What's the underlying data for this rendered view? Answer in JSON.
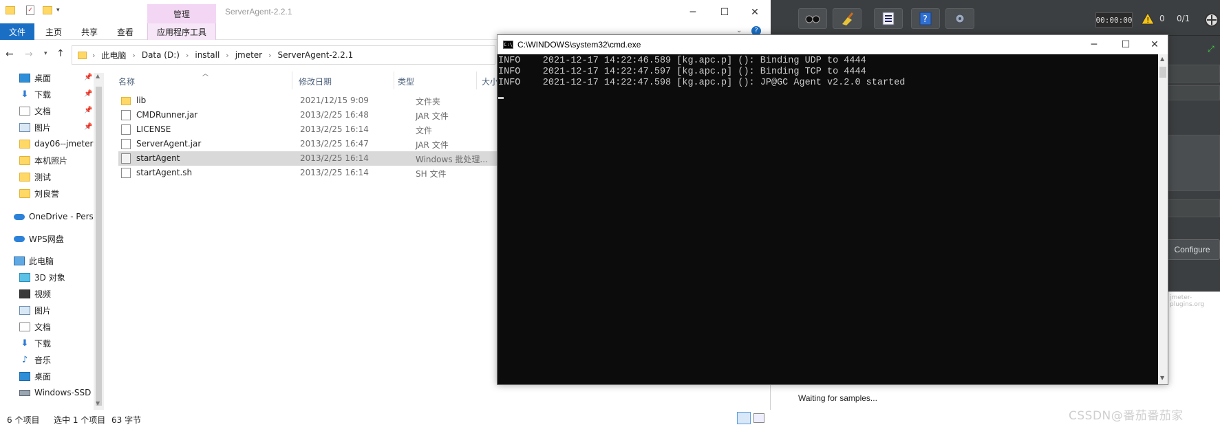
{
  "jmeter": {
    "timer": "00:00:00",
    "warning_count": "0",
    "thread_ratio": "0/1",
    "configure_label": "Configure",
    "watermark": "jmeter-plugins.org",
    "waiting_text": "Waiting for samples..."
  },
  "explorer": {
    "title": "ServerAgent-2.2.1",
    "manage_tab": "管理",
    "ribbon_tabs": [
      "文件",
      "主页",
      "共享",
      "查看",
      "应用程序工具"
    ],
    "breadcrumb": [
      "此电脑",
      "Data (D:)",
      "install",
      "jmeter",
      "ServerAgent-2.2.1"
    ],
    "nav_items": [
      {
        "label": "桌面",
        "icon": "desktop-icon",
        "pinned": true
      },
      {
        "label": "下载",
        "icon": "download-icon",
        "pinned": true
      },
      {
        "label": "文档",
        "icon": "document-icon",
        "pinned": true
      },
      {
        "label": "图片",
        "icon": "picture-icon",
        "pinned": true
      },
      {
        "label": "day06--jmeter",
        "icon": "folder-icon"
      },
      {
        "label": "本机照片",
        "icon": "folder-icon"
      },
      {
        "label": "测试",
        "icon": "folder-icon"
      },
      {
        "label": "刘良誉",
        "icon": "folder-icon"
      },
      {
        "label": "OneDrive - Perso",
        "icon": "cloud-icon"
      },
      {
        "label": "WPS网盘",
        "icon": "cloud-icon"
      },
      {
        "label": "此电脑",
        "icon": "computer-icon"
      },
      {
        "label": "3D 对象",
        "icon": "cube-icon"
      },
      {
        "label": "视频",
        "icon": "video-icon"
      },
      {
        "label": "图片",
        "icon": "picture-icon"
      },
      {
        "label": "文档",
        "icon": "document-icon"
      },
      {
        "label": "下载",
        "icon": "download-icon"
      },
      {
        "label": "音乐",
        "icon": "music-icon"
      },
      {
        "label": "桌面",
        "icon": "desktop-icon"
      },
      {
        "label": "Windows-SSD",
        "icon": "drive-icon"
      }
    ],
    "columns": {
      "name": "名称",
      "date": "修改日期",
      "type": "类型",
      "size": "大小"
    },
    "files": [
      {
        "name": "lib",
        "date": "2021/12/15 9:09",
        "type": "文件夹",
        "icon": "folder"
      },
      {
        "name": "CMDRunner.jar",
        "date": "2013/2/25 16:48",
        "type": "JAR 文件",
        "icon": "file"
      },
      {
        "name": "LICENSE",
        "date": "2013/2/25 16:14",
        "type": "文件",
        "icon": "file"
      },
      {
        "name": "ServerAgent.jar",
        "date": "2013/2/25 16:47",
        "type": "JAR 文件",
        "icon": "file"
      },
      {
        "name": "startAgent",
        "date": "2013/2/25 16:14",
        "type": "Windows 批处理...",
        "icon": "bat",
        "selected": true
      },
      {
        "name": "startAgent.sh",
        "date": "2013/2/25 16:14",
        "type": "SH 文件",
        "icon": "file"
      }
    ],
    "status": {
      "items": "6 个项目",
      "selected": "选中 1 个项目",
      "size": "63 字节"
    }
  },
  "cmd": {
    "title": "C:\\WINDOWS\\system32\\cmd.exe",
    "lines": [
      "INFO    2021-12-17 14:22:46.589 [kg.apc.p] (): Binding UDP to 4444",
      "INFO    2021-12-17 14:22:47.597 [kg.apc.p] (): Binding TCP to 4444",
      "INFO    2021-12-17 14:22:47.598 [kg.apc.p] (): JP@GC Agent v2.2.0 started"
    ]
  },
  "watermark": "CSSDN@番茄番茄家"
}
